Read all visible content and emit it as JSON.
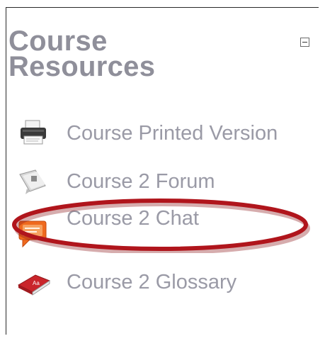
{
  "block": {
    "title_line1": "Course",
    "title_line2": "Resources",
    "items": [
      {
        "label": "Course Printed Version",
        "icon": "printer-icon"
      },
      {
        "label": "Course 2 Forum",
        "icon": "forum-icon"
      },
      {
        "label": "Course 2 Chat",
        "icon": "chat-icon"
      },
      {
        "label": "Course 2 Glossary",
        "icon": "glossary-icon"
      }
    ]
  },
  "colors": {
    "title": "#8f8f9a",
    "link": "#9a9aa6",
    "highlight": "#b0151c",
    "chat_icon": "#ef6a1e"
  }
}
